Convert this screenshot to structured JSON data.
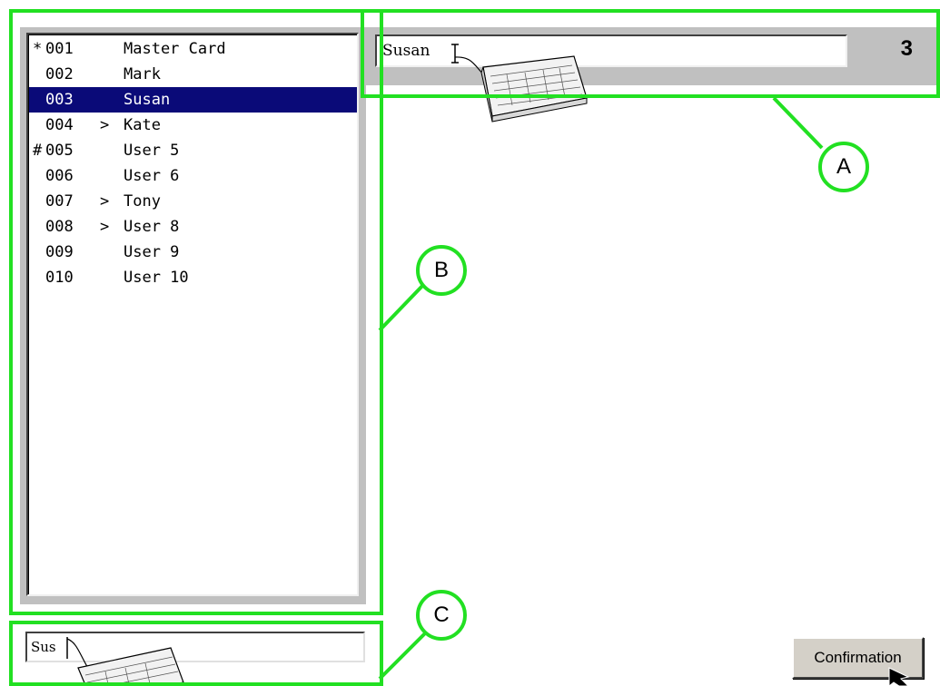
{
  "user_list": {
    "items": [
      {
        "prefix": "*",
        "number": "001",
        "arrow": "",
        "name": "Master Card",
        "selected": false
      },
      {
        "prefix": "",
        "number": "002",
        "arrow": "",
        "name": "Mark",
        "selected": false
      },
      {
        "prefix": "",
        "number": "003",
        "arrow": "",
        "name": "Susan",
        "selected": true
      },
      {
        "prefix": "",
        "number": "004",
        "arrow": ">",
        "name": "Kate",
        "selected": false
      },
      {
        "prefix": "#",
        "number": "005",
        "arrow": "",
        "name": "User 5",
        "selected": false
      },
      {
        "prefix": "",
        "number": "006",
        "arrow": "",
        "name": "User 6",
        "selected": false
      },
      {
        "prefix": "",
        "number": "007",
        "arrow": ">",
        "name": "Tony",
        "selected": false
      },
      {
        "prefix": "",
        "number": "008",
        "arrow": ">",
        "name": "User 8",
        "selected": false
      },
      {
        "prefix": "",
        "number": "009",
        "arrow": "",
        "name": "User 9",
        "selected": false
      },
      {
        "prefix": "",
        "number": "010",
        "arrow": "",
        "name": "User 10",
        "selected": false
      }
    ]
  },
  "name_field": {
    "value": "Susan",
    "number": "3"
  },
  "search_field": {
    "value": "Sus"
  },
  "confirm_button": {
    "label": "Confirmation"
  },
  "callouts": {
    "a": "A",
    "b": "B",
    "c": "C"
  },
  "icons": {
    "keyboard": "keyboard-icon",
    "cursor": "mouse-pointer-icon",
    "text_cursor": "text-cursor-icon"
  },
  "colors": {
    "highlight": "#22e022",
    "selection": "#0a0a78",
    "panel": "#c0c0c0"
  }
}
